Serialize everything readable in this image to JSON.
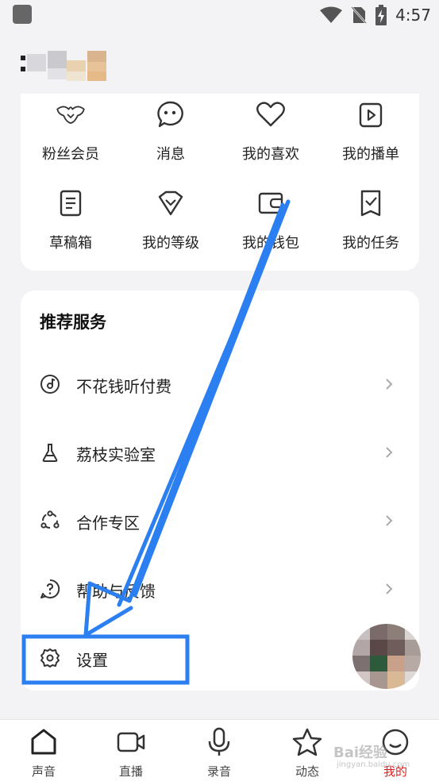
{
  "status_bar": {
    "time": "4:57"
  },
  "grid": {
    "items": [
      {
        "label": "粉丝会员",
        "icon": "fan-wings-heart-icon"
      },
      {
        "label": "消息",
        "icon": "message-bubble-icon"
      },
      {
        "label": "我的喜欢",
        "icon": "heart-icon"
      },
      {
        "label": "我的播单",
        "icon": "playlist-play-icon"
      },
      {
        "label": "草稿箱",
        "icon": "draft-doc-icon"
      },
      {
        "label": "我的等级",
        "icon": "level-diamond-icon"
      },
      {
        "label": "我的钱包",
        "icon": "wallet-icon"
      },
      {
        "label": "我的任务",
        "icon": "task-check-icon"
      }
    ]
  },
  "services": {
    "title": "推荐服务",
    "items": [
      {
        "label": "不花钱听付费",
        "icon": "music-disc-icon"
      },
      {
        "label": "荔枝实验室",
        "icon": "flask-icon"
      },
      {
        "label": "合作专区",
        "icon": "cooperation-icon"
      },
      {
        "label": "帮助与反馈",
        "icon": "help-circle-icon"
      },
      {
        "label": "设置",
        "icon": "gear-icon"
      }
    ]
  },
  "tabbar": {
    "tabs": [
      {
        "label": "声音",
        "icon": "house-icon"
      },
      {
        "label": "直播",
        "icon": "video-camera-icon"
      },
      {
        "label": "录音",
        "icon": "microphone-icon"
      },
      {
        "label": "动态",
        "icon": "star-icon"
      },
      {
        "label": "我的",
        "icon": "profile-face-icon"
      }
    ],
    "active_color": "#e02020"
  },
  "annotation": {
    "color": "#2b7ff0"
  },
  "watermark": {
    "line1": "Bai经验",
    "line2": "jingyan.baidu.com"
  }
}
